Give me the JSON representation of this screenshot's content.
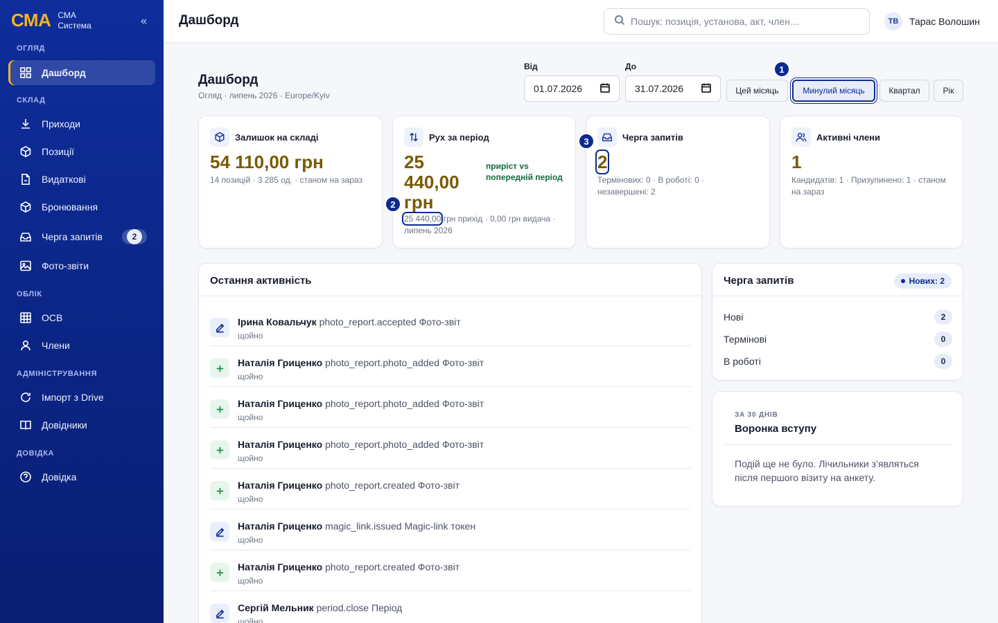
{
  "brand": {
    "logo": "СМА",
    "line1": "СМА",
    "line2": "Система",
    "collapse": "«"
  },
  "sidebar": {
    "sections": [
      {
        "title": "ОГЛЯД"
      },
      {
        "title": "СКЛАД"
      },
      {
        "title": "ОБЛІК"
      },
      {
        "title": "АДМІНІСТРУВАННЯ"
      },
      {
        "title": "ДОВІДКА"
      }
    ],
    "items": [
      {
        "label": "Дашборд",
        "icon": "dashboard-icon",
        "active": true
      },
      {
        "label": "Приходи",
        "icon": "download-icon"
      },
      {
        "label": "Позиції",
        "icon": "box-icon"
      },
      {
        "label": "Видаткові",
        "icon": "document-icon"
      },
      {
        "label": "Бронювання",
        "icon": "box-icon"
      },
      {
        "label": "Черга запитів",
        "icon": "inbox-icon",
        "badge": "2"
      },
      {
        "label": "Фото-звіти",
        "icon": "image-icon"
      },
      {
        "label": "ОСВ",
        "icon": "table-icon"
      },
      {
        "label": "Члени",
        "icon": "user-icon"
      },
      {
        "label": "Імпорт з Drive",
        "icon": "refresh-icon"
      },
      {
        "label": "Довідники",
        "icon": "book-icon"
      },
      {
        "label": "Довідка",
        "icon": "help-icon"
      }
    ]
  },
  "topbar": {
    "title": "Дашборд",
    "search_placeholder": "Пошук: позиція, установа, акт, член…",
    "user_initials": "ТВ",
    "user_name": "Тарас Волошин"
  },
  "page": {
    "title": "Дашборд",
    "subtitle": "Огляд · липень 2026 · Europe/Kyiv",
    "from_label": "Від",
    "from_value": "01.07.2026",
    "to_label": "До",
    "to_value": "31.07.2026",
    "periods": [
      "Цей місяць",
      "Минулий місяць",
      "Квартал",
      "Рік"
    ],
    "selected_period": "Минулий місяць",
    "markers": [
      "1",
      "2",
      "3"
    ]
  },
  "stats": {
    "stock": {
      "title": "Залишок на складі",
      "value": "54 110,00 грн",
      "note": "14 позицій · 3 285 од. · станом на зараз"
    },
    "movement": {
      "title": "Рух за період",
      "value_line1": "25",
      "value_line2": "440,00",
      "value_line3": "грн",
      "growth": "приріст vs попередній період",
      "note_highlight": "25 440,00",
      "note_rest": " грн прихід · 0,00 грн видача ·",
      "note_line2": "липень 2026"
    },
    "queue": {
      "title": "Черга запитів",
      "value": "2",
      "note_line1": "Термінових: 0 · В роботі: 0 ·",
      "note_line2": "незавершені: 2"
    },
    "members": {
      "title": "Активні члени",
      "value": "1",
      "note_line1": "Кандидатів: 1 · Призупинено: 1 · станом",
      "note_line2": "на зараз"
    }
  },
  "activity": {
    "title": "Остання активність",
    "rows": [
      {
        "user": "Ірина Ковальчук",
        "action": "photo_report.accepted Фото-звіт",
        "time": "щойно",
        "icon": "edit-icon"
      },
      {
        "user": "Наталія Гриценко",
        "action": "photo_report.photo_added Фото-звіт",
        "time": "щойно",
        "icon": "plus-icon"
      },
      {
        "user": "Наталія Гриценко",
        "action": "photo_report.photo_added Фото-звіт",
        "time": "щойно",
        "icon": "plus-icon"
      },
      {
        "user": "Наталія Гриценко",
        "action": "photo_report.photo_added Фото-звіт",
        "time": "щойно",
        "icon": "plus-icon"
      },
      {
        "user": "Наталія Гриценко",
        "action": "photo_report.created Фото-звіт",
        "time": "щойно",
        "icon": "plus-icon"
      },
      {
        "user": "Наталія Гриценко",
        "action": "magic_link.issued Magic-link токен",
        "time": "щойно",
        "icon": "edit-icon"
      },
      {
        "user": "Наталія Гриценко",
        "action": "photo_report.created Фото-звіт",
        "time": "щойно",
        "icon": "plus-icon"
      },
      {
        "user": "Сергій Мельник",
        "action": "period.close Період",
        "time": "щойно",
        "icon": "edit-icon"
      }
    ]
  },
  "queue_panel": {
    "title": "Черга запитів",
    "badge": "Нових: 2",
    "rows": [
      {
        "label": "Нові",
        "count": "2"
      },
      {
        "label": "Термінові",
        "count": "0"
      },
      {
        "label": "В роботі",
        "count": "0"
      }
    ]
  },
  "funnel": {
    "kicker": "ЗА 30 ДНІВ",
    "title": "Воронка вступу",
    "text": "Подій ще не було. Лічильники з’являться після першого візиту на анкету."
  },
  "colors": {
    "sidebar": "#0f2e9c",
    "accent": "#f2b41c",
    "value": "#7a5a00",
    "growth": "#0f6b3b",
    "primary": "#0c2a8e"
  }
}
